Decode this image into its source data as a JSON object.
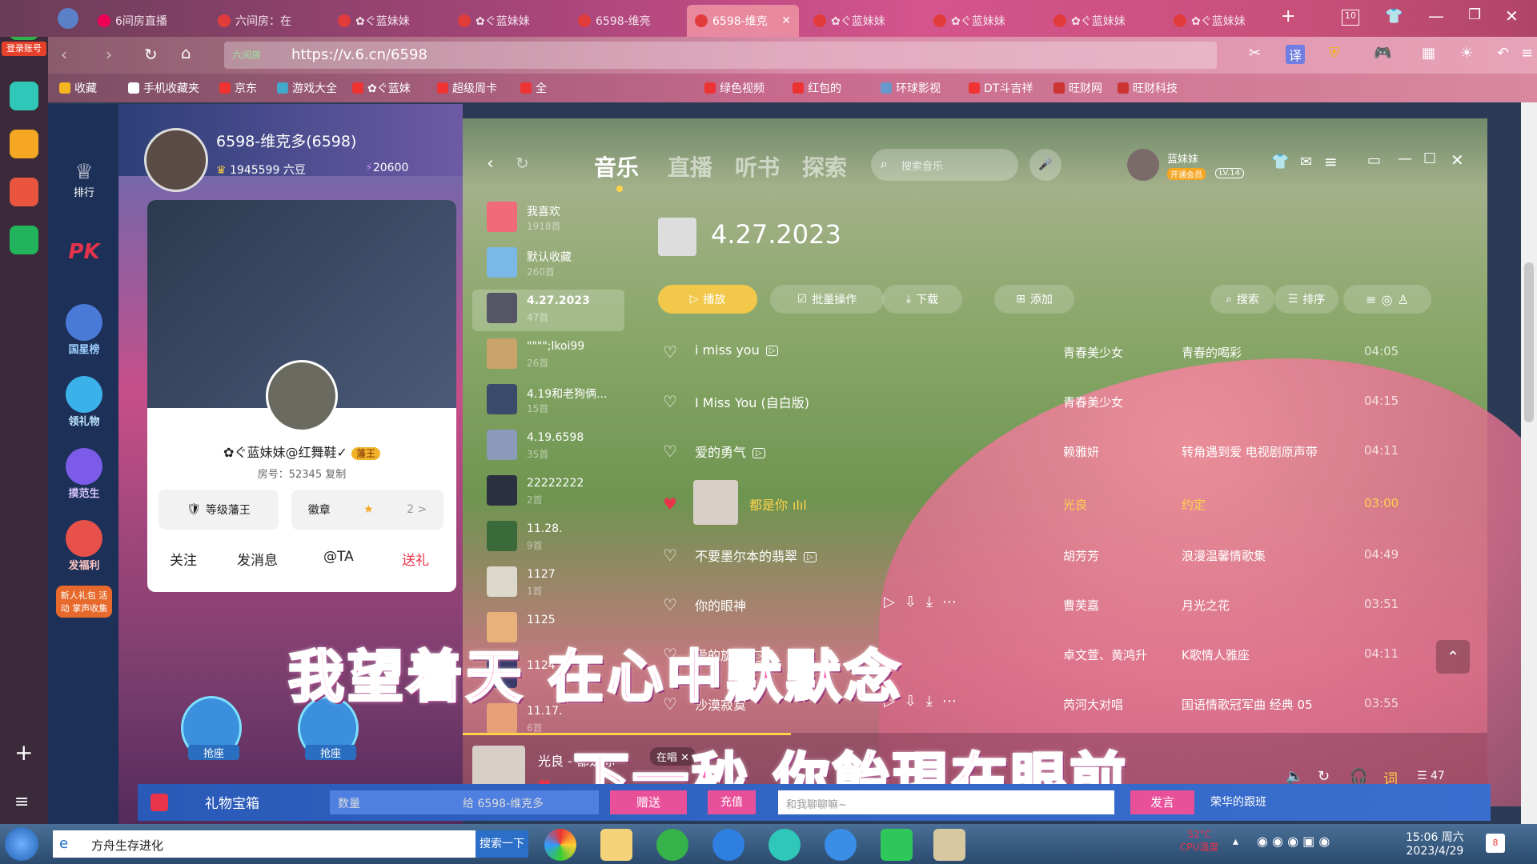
{
  "browser": {
    "tabs": [
      {
        "label": "6间房直播"
      },
      {
        "label": "六间房：在"
      },
      {
        "label": "✿ぐ蓝妹妹"
      },
      {
        "label": "✿ぐ蓝妹妹"
      },
      {
        "label": "6598-维亮"
      },
      {
        "label": "6598-维克",
        "active": true
      },
      {
        "label": "✿ぐ蓝妹妹"
      },
      {
        "label": "✿ぐ蓝妹妹"
      },
      {
        "label": "✿ぐ蓝妹妹"
      },
      {
        "label": "✿ぐ蓝妹妹"
      }
    ],
    "tab_count": "10",
    "login_label": "登录账号",
    "url": "https://v.6.cn/6598",
    "site_badge": "六间房",
    "translate_label": "译",
    "bookmarks": [
      "收藏",
      "手机收藏夹",
      "京东",
      "游戏大全",
      "✿ぐ蓝妹",
      "超级周卡",
      "全",
      "绿色视频",
      "红包的",
      "环球影视",
      "DT斗吉祥",
      "旺财网",
      "旺财科技"
    ]
  },
  "left_nav": {
    "items": [
      "排行",
      "PK",
      "国星榜",
      "领礼物",
      "摸范生",
      "发福利",
      "新人礼包 活动 掌声收集"
    ]
  },
  "room": {
    "anchor_name": "6598-维克多(6598)",
    "coins": "1945599 六豆",
    "fans": "20600",
    "card_name": "✿ぐ蓝妹妹@红舞鞋✓",
    "card_badge": "藩王",
    "room_no": "房号：52345",
    "copy_label": "复制",
    "level_label": "等级藩王",
    "medal_label": "徽章",
    "medal_more": "2 >",
    "actions": [
      "关注",
      "发消息",
      "@TA",
      "送礼"
    ],
    "seat_labels": [
      "抢座",
      "抢座"
    ],
    "bottom": {
      "gift_box": "礼物宝箱",
      "qty_placeholder": "数量",
      "to_label": "给 6598-维克多",
      "gift_btn": "赠送",
      "recharge_btn": "充值",
      "chat_placeholder": "和我聊聊嘛~",
      "send_btn": "发言",
      "right_text": "荣华的跟班"
    }
  },
  "music": {
    "nav": [
      "音乐",
      "直播",
      "听书",
      "探索"
    ],
    "search_placeholder": "搜索音乐",
    "user": {
      "name": "蓝妹妹",
      "vip": "开通会员",
      "level": "LV.14"
    },
    "playlists": [
      {
        "title": "我喜欢",
        "count": "1918首"
      },
      {
        "title": "默认收藏",
        "count": "260首"
      },
      {
        "title": "4.27.2023",
        "count": "47首",
        "active": true
      },
      {
        "title": "\"\"\"\";lkoi99",
        "count": "26首"
      },
      {
        "title": "4.19和老狗俩...",
        "count": "15首"
      },
      {
        "title": "4.19.6598",
        "count": "35首"
      },
      {
        "title": "22222222",
        "count": "2首"
      },
      {
        "title": "11.28.",
        "count": "9首"
      },
      {
        "title": "1127",
        "count": "1首"
      },
      {
        "title": "1125",
        "count": ""
      },
      {
        "title": "1124",
        "count": ""
      },
      {
        "title": "11.17.",
        "count": "6首"
      }
    ],
    "playlist_title": "4.27.2023",
    "actions": [
      "播放",
      "批量操作",
      "下载",
      "添加",
      "搜索",
      "排序"
    ],
    "songs": [
      {
        "name": "i miss you",
        "artist": "青春美少女",
        "album": "青春的喝彩",
        "duration": "04:05",
        "mv": true
      },
      {
        "name": "I Miss You (自白版)",
        "artist": "青春美少女",
        "album": "",
        "duration": "04:15",
        "mv": false
      },
      {
        "name": "爱的勇气",
        "artist": "赖雅妍",
        "album": "转角遇到爱 电视剧原声带",
        "duration": "04:11",
        "mv": true
      },
      {
        "name": "都是你",
        "artist": "光良",
        "album": "约定",
        "duration": "03:00",
        "mv": false,
        "playing": true
      },
      {
        "name": "不要墨尔本的翡翠",
        "artist": "胡芳芳",
        "album": "浪漫温馨情歌集",
        "duration": "04:49",
        "mv": true
      },
      {
        "name": "你的眼神",
        "artist": "曹芙嘉",
        "album": "月光之花",
        "duration": "03:51",
        "mv": false
      },
      {
        "name": "爱的旋律",
        "artist": "卓文萱、黄鸿升",
        "album": "K歌情人雅座",
        "duration": "04:11",
        "mv": true
      },
      {
        "name": "沙漠寂寞",
        "artist": "芮河大对唱",
        "album": "国语情歌冠军曲 经典 05",
        "duration": "03:55",
        "mv": false
      }
    ],
    "player": {
      "now": "光良 - 都是你",
      "status": "在唱",
      "lyric_btn": "词",
      "queue_count": "47"
    }
  },
  "lyrics": {
    "line1": "我望着天 在心中默默念",
    "line2": "下一秒 你飴現在眼前"
  },
  "taskbar": {
    "search_text": "方舟生存进化",
    "search_btn": "搜索一下",
    "cpu": "52°C",
    "cpu_label": "CPU温度",
    "time": "15:06 周六",
    "date": "2023/4/29",
    "badge": "8"
  }
}
